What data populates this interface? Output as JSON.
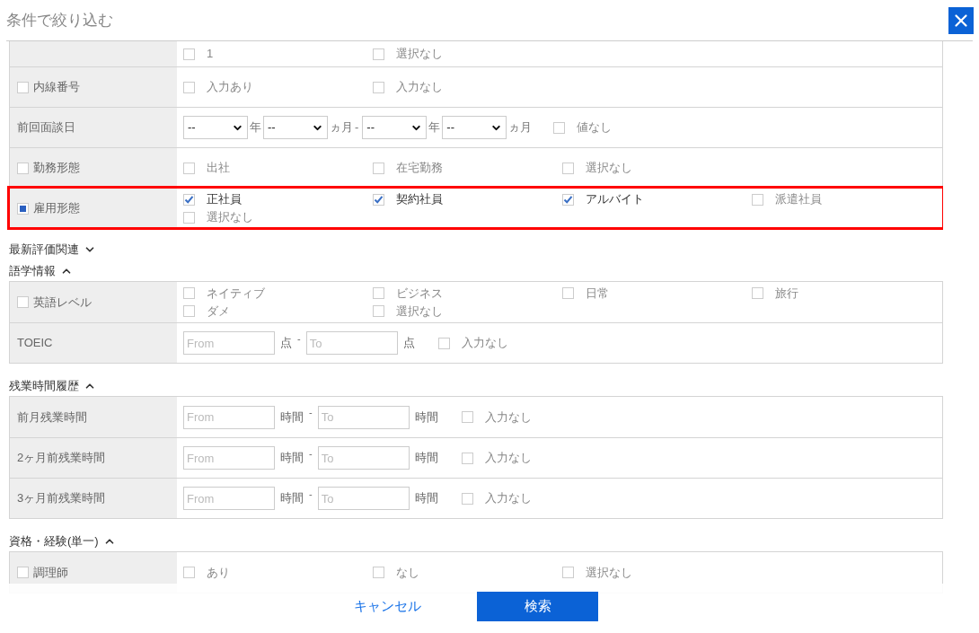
{
  "dialog": {
    "title": "条件で絞り込む"
  },
  "sections": [
    {
      "rows": [
        {
          "kind": "checks",
          "clipped": true,
          "label": "",
          "options": [
            {
              "label": "1",
              "checked": false
            },
            {
              "label": "選択なし",
              "checked": false
            }
          ]
        },
        {
          "kind": "checks",
          "label": "内線番号",
          "checked": false,
          "partial": false,
          "options": [
            {
              "label": "入力あり",
              "checked": false
            },
            {
              "label": "入力なし",
              "checked": false
            }
          ]
        },
        {
          "kind": "dates",
          "label": "前回面談日",
          "from": [
            {
              "value": "--",
              "unit": "年"
            },
            {
              "value": "--",
              "unit": "ヵ月"
            }
          ],
          "separator": "-",
          "to": [
            {
              "value": "--",
              "unit": "年"
            },
            {
              "value": "--",
              "unit": "ヵ月"
            }
          ],
          "options": [
            {
              "label": "値なし",
              "checked": false
            }
          ]
        },
        {
          "kind": "checks",
          "label": "勤務形態",
          "checked": false,
          "partial": false,
          "options": [
            {
              "label": "出社",
              "checked": false
            },
            {
              "label": "在宅勤務",
              "checked": false
            },
            {
              "label": "選択なし",
              "checked": false
            }
          ]
        },
        {
          "kind": "checks",
          "label": "雇用形態",
          "checked": false,
          "partial": true,
          "highlighted": true,
          "options": [
            {
              "label": "正社員",
              "checked": true
            },
            {
              "label": "契約社員",
              "checked": true
            },
            {
              "label": "アルバイト",
              "checked": true
            },
            {
              "label": "派遣社員",
              "checked": false
            },
            {
              "label": "選択なし",
              "checked": false
            }
          ]
        }
      ]
    },
    {
      "heading": "最新評価関連",
      "expanded": false
    },
    {
      "heading": "語学情報",
      "expanded": true,
      "rows": [
        {
          "kind": "checks",
          "label": "英語レベル",
          "checked": false,
          "partial": false,
          "options": [
            {
              "label": "ネイティブ",
              "checked": false
            },
            {
              "label": "ビジネス",
              "checked": false
            },
            {
              "label": "日常",
              "checked": false
            },
            {
              "label": "旅行",
              "checked": false
            },
            {
              "label": "ダメ",
              "checked": false
            },
            {
              "label": "選択なし",
              "checked": false
            }
          ]
        },
        {
          "kind": "range",
          "label": "TOEIC",
          "from_placeholder": "From",
          "unit": "点",
          "separator": "-",
          "to_placeholder": "To",
          "unit_after": "点",
          "options": [
            {
              "label": "入力なし",
              "checked": false
            }
          ]
        }
      ]
    },
    {
      "heading": "残業時間履歴",
      "expanded": true,
      "rows": [
        {
          "kind": "range",
          "label": "前月残業時間",
          "from_placeholder": "From",
          "unit": "時間",
          "separator": "-",
          "to_placeholder": "To",
          "unit_after": "時間",
          "options": [
            {
              "label": "入力なし",
              "checked": false
            }
          ]
        },
        {
          "kind": "range",
          "label": "2ヶ月前残業時間",
          "from_placeholder": "From",
          "unit": "時間",
          "separator": "-",
          "to_placeholder": "To",
          "unit_after": "時間",
          "options": [
            {
              "label": "入力なし",
              "checked": false
            }
          ]
        },
        {
          "kind": "range",
          "label": "3ヶ月前残業時間",
          "from_placeholder": "From",
          "unit": "時間",
          "separator": "-",
          "to_placeholder": "To",
          "unit_after": "時間",
          "options": [
            {
              "label": "入力なし",
              "checked": false
            }
          ]
        }
      ]
    },
    {
      "heading": "資格・経験(単一)",
      "expanded": true,
      "rows": [
        {
          "kind": "checks",
          "label": "調理師",
          "checked": false,
          "partial": false,
          "options": [
            {
              "label": "あり",
              "checked": false
            },
            {
              "label": "なし",
              "checked": false
            },
            {
              "label": "選択なし",
              "checked": false
            }
          ]
        }
      ]
    }
  ],
  "footer": {
    "cancel": "キャンセル",
    "search": "検索"
  }
}
